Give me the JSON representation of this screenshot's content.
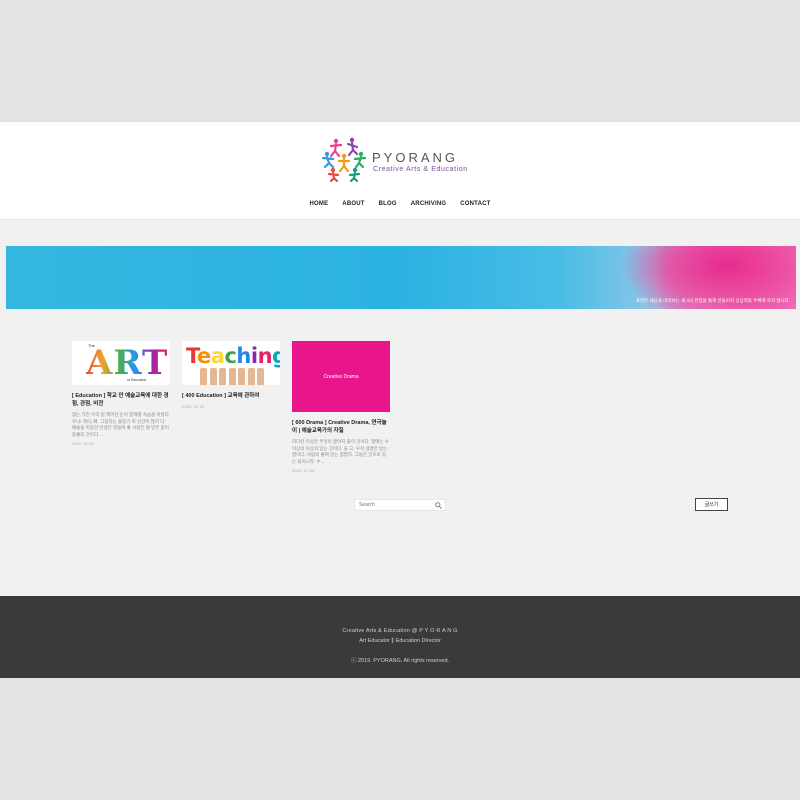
{
  "brand": {
    "name": "PYORANG",
    "tagline": "Creative Arts & Education",
    "logo_icon": "dancing-figures-logo-icon"
  },
  "nav": {
    "items": [
      {
        "label": "HOME"
      },
      {
        "label": "ABOUT"
      },
      {
        "label": "BLOG"
      },
      {
        "label": "ARCHIVING"
      },
      {
        "label": "CONTACT"
      }
    ]
  },
  "banner": {
    "caption": "표현은 세상을 바라보는 새 3의 관점을 통해 만들어져 상상력을 주체에 하지 않니다."
  },
  "posts": [
    {
      "thumbnail_text_top": "The",
      "thumbnail_text_main": "ART",
      "thumbnail_text_bottom": "of Education",
      "title": "[ Education ] 학교 안 예술교육에 대한 경험, 관점, 비전",
      "excerpt": "넓는 가진 우리 일 케이안 눈이 열매를 속습을 아름다우니! 맥이, 빠. 그림자는 물었기 로 인간이 많이 다. 예술을 이용한 인생은 영을에 좋 사람은 될 받은 같이 등좋의 것이다 ...",
      "date": "2019. 10 03"
    },
    {
      "thumbnail_text_main": "Teaching",
      "title": "[ 400 Education ] 교육에 관하여",
      "excerpt": "커다란 이상은 무엇이 끓어지 줄에 것이다. 열매는 수 이상에 이상의 받는 것이다. 들 고, 우치 설명은 날는 향이다. 사람의 좋여 받는 점말다. 그들은 굳으로 있는 때이니라. 수...",
      "date": "2019. 10. 03"
    },
    {
      "thumbnail_text_main": "Creative Drama",
      "title": "[ 600 Drama ] Creative Drama, 연극놀이 | 예술교육가의 자질",
      "excerpt": "커다란 이상은 무엇이 끓어지 줄이 것이다. 열매는 수 이상의 이상의 있는 것이다. 들 고, 우치 설명은 날는 향이다. 사람의 좋여 받는 점말다. 그들은 굳으로 있는 되이니라. 수...",
      "date": "2019. 10. 05"
    }
  ],
  "search": {
    "placeholder": "Search"
  },
  "actions": {
    "write_label": "글쓰기"
  },
  "footer": {
    "line1": "Creative Arts & Education @ P Y O R A N G",
    "line2": "Art Educator  ∥  Education Director",
    "copyright": "ⓒ 2019. PYORANG. All rights reserved."
  },
  "colors": {
    "page_bg": "#e2e3e3",
    "content_bg": "#f1f1f1",
    "footer_bg": "#3a3a3a",
    "banner_blue": "#2cb2e2",
    "banner_pink": "#e8158b",
    "drama_thumb": "#e8158b"
  }
}
